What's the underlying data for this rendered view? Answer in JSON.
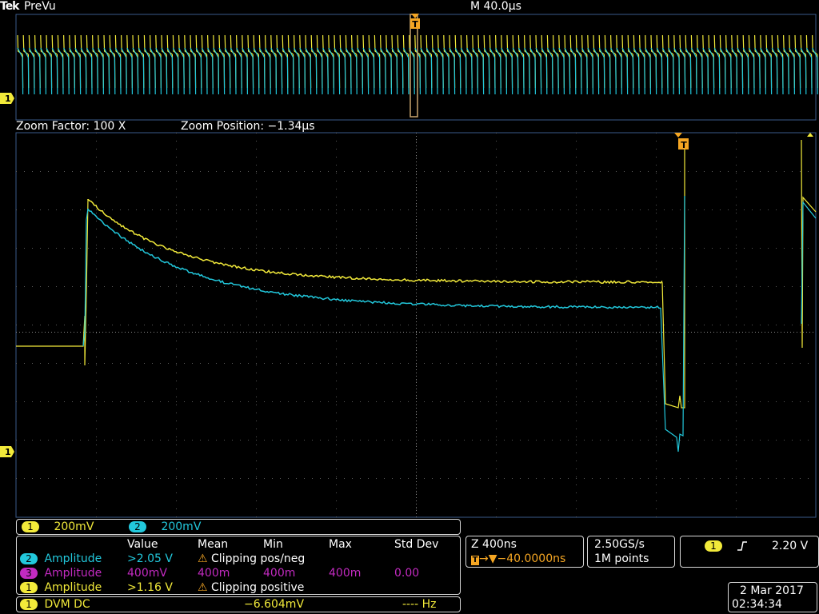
{
  "header": {
    "brand": "Tek",
    "mode": "PreVu",
    "timebase": "M 40.0µs"
  },
  "zoom": {
    "factor_label": "Zoom Factor: 100 X",
    "position_label": "Zoom Position: −1.34µs"
  },
  "markers": {
    "trigger": "T",
    "ch1": "1"
  },
  "channels": [
    {
      "num": "1",
      "scale": "200mV",
      "color": "#f2ea3a"
    },
    {
      "num": "2",
      "scale": "200mV",
      "color": "#22c8dc"
    }
  ],
  "measurements": {
    "headers": [
      "Value",
      "Mean",
      "Min",
      "Max",
      "Std Dev"
    ],
    "rows": [
      {
        "ch": "2",
        "label": "Amplitude",
        "value": ">2.05 V",
        "warning": "Clipping pos/neg"
      },
      {
        "ch": "3",
        "label": "Amplitude",
        "value": "400mV",
        "mean": "400m",
        "min": "400m",
        "max": "400m",
        "std": "0.00"
      },
      {
        "ch": "1",
        "label": "Amplitude",
        "value": ">1.16 V",
        "warning": "Clipping positive"
      }
    ],
    "dvm": {
      "ch": "1",
      "label": "DVM DC",
      "value": "−6.604mV",
      "freq": "---- Hz"
    }
  },
  "horizontal": {
    "zoom_scale": "Z 400ns",
    "trigger_delay": "→▼−40.0000ns"
  },
  "acquisition": {
    "sample_rate": "2.50GS/s",
    "record_length": "1M points"
  },
  "trigger": {
    "ch": "1",
    "slope_icon": "rising-edge-icon",
    "level": "2.20 V"
  },
  "datetime": {
    "date": "2 Mar 2017",
    "time": "02:34:34"
  },
  "colors": {
    "ch1": "#f2ea3a",
    "ch2": "#22c8dc",
    "ch3": "#c22ac0",
    "trigger": "#f5a623"
  }
}
